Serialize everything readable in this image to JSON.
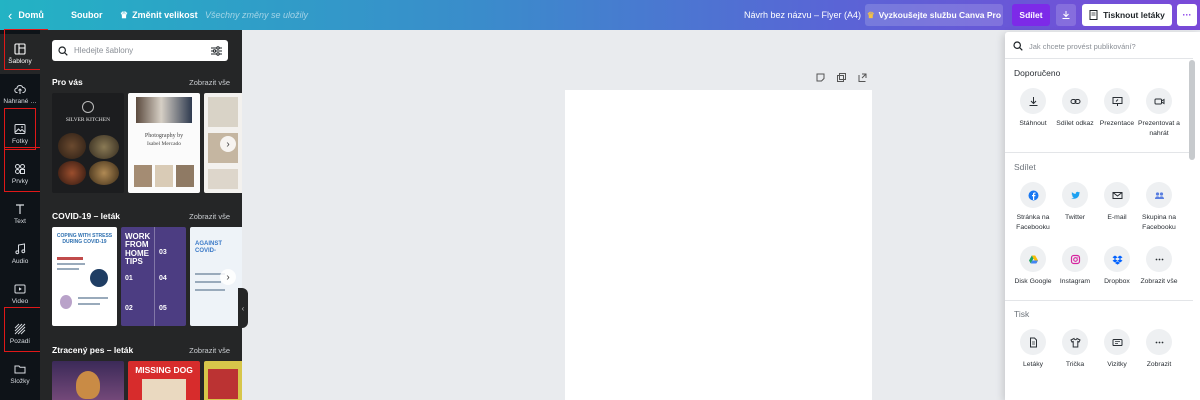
{
  "topbar": {
    "home": "Domů",
    "file": "Soubor",
    "resize": "Změnit velikost",
    "saved": "Všechny změny se uložily",
    "design_title": "Návrh bez názvu – Flyer (A4)",
    "pro": "Vyzkoušejte službu Canva Pro",
    "share": "Sdílet",
    "print": "Tisknout letáky",
    "more": "···"
  },
  "rail": [
    "Šablony",
    "Nahrané …",
    "Fotky",
    "Prvky",
    "Text",
    "Audio",
    "Video",
    "Pozadí",
    "Složky"
  ],
  "panel": {
    "search_placeholder": "Hledejte šablony",
    "sections": [
      {
        "title": "Pro vás",
        "see_all": "Zobrazit vše"
      },
      {
        "title": "COVID-19 – leták",
        "see_all": "Zobrazit vše"
      },
      {
        "title": "Ztracený pes – leták",
        "see_all": "Zobrazit vše"
      }
    ],
    "thumbs": {
      "silver_kitchen": "SILVER KITCHEN",
      "photography_by": "Photography by",
      "isabel": "Isabel Mercado",
      "coping": "COPING WITH STRESS DURING COVID-19",
      "work_from_home": "WORK FROM HOME TIPS",
      "numbers": [
        "01",
        "02",
        "03",
        "04",
        "05"
      ],
      "against": "AGAINST COVID-",
      "missing_dog": "MISSING DOG"
    }
  },
  "share_menu": {
    "search_placeholder": "Jak chcete provést publikování?",
    "recommended": "Doporučeno",
    "recommended_items": [
      "Stáhnout",
      "Sdílet odkaz",
      "Prezentace",
      "Prezentovat a nahrát"
    ],
    "share_heading": "Sdílet",
    "share_items": [
      "Stránka na Facebooku",
      "Twitter",
      "E-mail",
      "Skupina na Facebooku"
    ],
    "share_items2": [
      "Disk Google",
      "Instagram",
      "Dropbox",
      "Zobrazit vše"
    ],
    "print_heading": "Tisk",
    "print_items": [
      "Letáky",
      "Trička",
      "Vizitky",
      "Zobrazit"
    ]
  },
  "colors": {
    "accent": "#7d2ae8",
    "highlight": "#e01818",
    "rail_bg": "#0e1318",
    "panel_bg": "#252627"
  }
}
